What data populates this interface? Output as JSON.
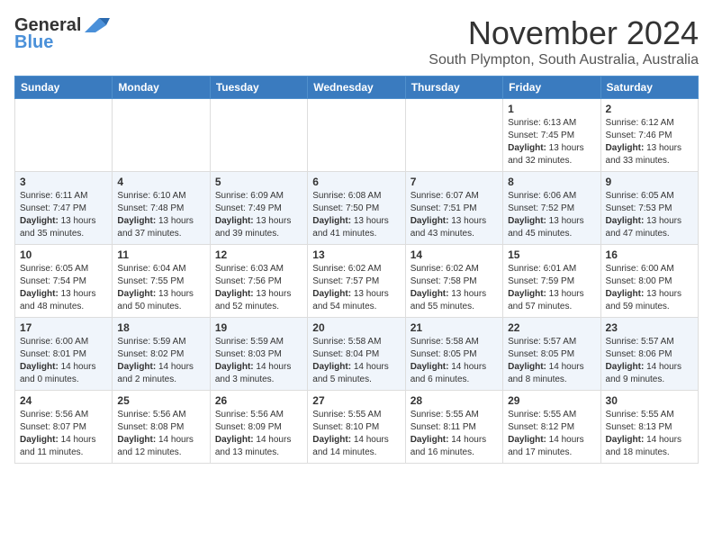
{
  "logo": {
    "general": "General",
    "blue": "Blue"
  },
  "title": "November 2024",
  "location": "South Plympton, South Australia, Australia",
  "days_header": [
    "Sunday",
    "Monday",
    "Tuesday",
    "Wednesday",
    "Thursday",
    "Friday",
    "Saturday"
  ],
  "weeks": [
    [
      {
        "day": "",
        "info": ""
      },
      {
        "day": "",
        "info": ""
      },
      {
        "day": "",
        "info": ""
      },
      {
        "day": "",
        "info": ""
      },
      {
        "day": "",
        "info": ""
      },
      {
        "day": "1",
        "info": "Sunrise: 6:13 AM\nSunset: 7:45 PM\nDaylight: 13 hours and 32 minutes."
      },
      {
        "day": "2",
        "info": "Sunrise: 6:12 AM\nSunset: 7:46 PM\nDaylight: 13 hours and 33 minutes."
      }
    ],
    [
      {
        "day": "3",
        "info": "Sunrise: 6:11 AM\nSunset: 7:47 PM\nDaylight: 13 hours and 35 minutes."
      },
      {
        "day": "4",
        "info": "Sunrise: 6:10 AM\nSunset: 7:48 PM\nDaylight: 13 hours and 37 minutes."
      },
      {
        "day": "5",
        "info": "Sunrise: 6:09 AM\nSunset: 7:49 PM\nDaylight: 13 hours and 39 minutes."
      },
      {
        "day": "6",
        "info": "Sunrise: 6:08 AM\nSunset: 7:50 PM\nDaylight: 13 hours and 41 minutes."
      },
      {
        "day": "7",
        "info": "Sunrise: 6:07 AM\nSunset: 7:51 PM\nDaylight: 13 hours and 43 minutes."
      },
      {
        "day": "8",
        "info": "Sunrise: 6:06 AM\nSunset: 7:52 PM\nDaylight: 13 hours and 45 minutes."
      },
      {
        "day": "9",
        "info": "Sunrise: 6:05 AM\nSunset: 7:53 PM\nDaylight: 13 hours and 47 minutes."
      }
    ],
    [
      {
        "day": "10",
        "info": "Sunrise: 6:05 AM\nSunset: 7:54 PM\nDaylight: 13 hours and 48 minutes."
      },
      {
        "day": "11",
        "info": "Sunrise: 6:04 AM\nSunset: 7:55 PM\nDaylight: 13 hours and 50 minutes."
      },
      {
        "day": "12",
        "info": "Sunrise: 6:03 AM\nSunset: 7:56 PM\nDaylight: 13 hours and 52 minutes."
      },
      {
        "day": "13",
        "info": "Sunrise: 6:02 AM\nSunset: 7:57 PM\nDaylight: 13 hours and 54 minutes."
      },
      {
        "day": "14",
        "info": "Sunrise: 6:02 AM\nSunset: 7:58 PM\nDaylight: 13 hours and 55 minutes."
      },
      {
        "day": "15",
        "info": "Sunrise: 6:01 AM\nSunset: 7:59 PM\nDaylight: 13 hours and 57 minutes."
      },
      {
        "day": "16",
        "info": "Sunrise: 6:00 AM\nSunset: 8:00 PM\nDaylight: 13 hours and 59 minutes."
      }
    ],
    [
      {
        "day": "17",
        "info": "Sunrise: 6:00 AM\nSunset: 8:01 PM\nDaylight: 14 hours and 0 minutes."
      },
      {
        "day": "18",
        "info": "Sunrise: 5:59 AM\nSunset: 8:02 PM\nDaylight: 14 hours and 2 minutes."
      },
      {
        "day": "19",
        "info": "Sunrise: 5:59 AM\nSunset: 8:03 PM\nDaylight: 14 hours and 3 minutes."
      },
      {
        "day": "20",
        "info": "Sunrise: 5:58 AM\nSunset: 8:04 PM\nDaylight: 14 hours and 5 minutes."
      },
      {
        "day": "21",
        "info": "Sunrise: 5:58 AM\nSunset: 8:05 PM\nDaylight: 14 hours and 6 minutes."
      },
      {
        "day": "22",
        "info": "Sunrise: 5:57 AM\nSunset: 8:05 PM\nDaylight: 14 hours and 8 minutes."
      },
      {
        "day": "23",
        "info": "Sunrise: 5:57 AM\nSunset: 8:06 PM\nDaylight: 14 hours and 9 minutes."
      }
    ],
    [
      {
        "day": "24",
        "info": "Sunrise: 5:56 AM\nSunset: 8:07 PM\nDaylight: 14 hours and 11 minutes."
      },
      {
        "day": "25",
        "info": "Sunrise: 5:56 AM\nSunset: 8:08 PM\nDaylight: 14 hours and 12 minutes."
      },
      {
        "day": "26",
        "info": "Sunrise: 5:56 AM\nSunset: 8:09 PM\nDaylight: 14 hours and 13 minutes."
      },
      {
        "day": "27",
        "info": "Sunrise: 5:55 AM\nSunset: 8:10 PM\nDaylight: 14 hours and 14 minutes."
      },
      {
        "day": "28",
        "info": "Sunrise: 5:55 AM\nSunset: 8:11 PM\nDaylight: 14 hours and 16 minutes."
      },
      {
        "day": "29",
        "info": "Sunrise: 5:55 AM\nSunset: 8:12 PM\nDaylight: 14 hours and 17 minutes."
      },
      {
        "day": "30",
        "info": "Sunrise: 5:55 AM\nSunset: 8:13 PM\nDaylight: 14 hours and 18 minutes."
      }
    ]
  ]
}
